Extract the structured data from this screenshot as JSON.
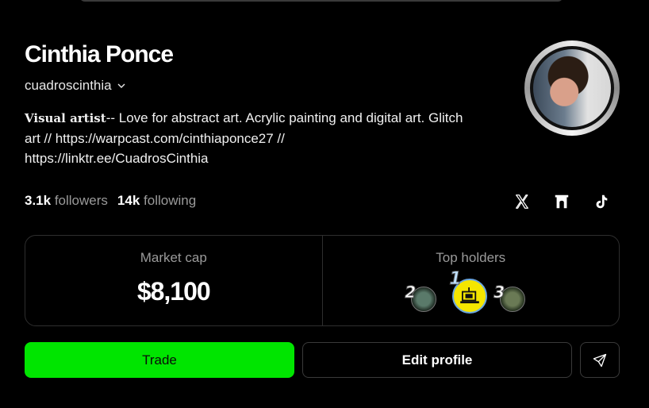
{
  "profile": {
    "name": "Cinthia Ponce",
    "handle": "cuadroscinthia",
    "bio_prefix": "Visual artist",
    "bio_rest": "-- Love for abstract art. Acrylic painting and digital art. Glitch art // https://warpcast.com/cinthiaponce27 // https://linktr.ee/CuadrosCinthia"
  },
  "stats": {
    "followers_count": "3.1k",
    "followers_label": "followers",
    "following_count": "14k",
    "following_label": "following"
  },
  "socials": [
    "x-icon",
    "warpcast-icon",
    "tiktok-icon"
  ],
  "market": {
    "cap_label": "Market cap",
    "cap_value": "$8,100",
    "holders_label": "Top holders",
    "holders": [
      {
        "rank": "2"
      },
      {
        "rank": "1"
      },
      {
        "rank": "3"
      }
    ]
  },
  "actions": {
    "trade_label": "Trade",
    "edit_label": "Edit profile"
  },
  "colors": {
    "background": "#000000",
    "trade_button": "#00e500",
    "muted_text": "#9a9a9a"
  }
}
